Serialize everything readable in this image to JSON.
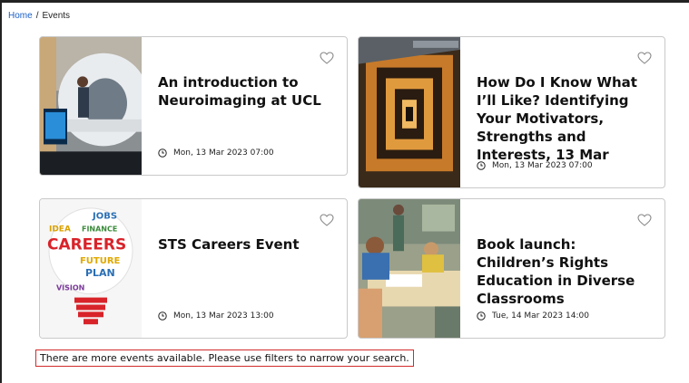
{
  "breadcrumb": {
    "home": "Home",
    "separator": "/",
    "current": "Events"
  },
  "colors": {
    "link": "#1a5fc8",
    "notice_border": "#d12b2b",
    "card_border": "#c9c9c9"
  },
  "icons": {
    "favourite": "heart-outline-icon",
    "time": "clock-icon"
  },
  "events": [
    {
      "title": "An introduction to Neuroimaging at UCL",
      "date": "Mon, 13 Mar 2023 07:00"
    },
    {
      "title": "How Do I Know What I’ll Like? Identifying Your Motivators, Strengths and Interests, 13 Mar",
      "date": "Mon, 13 Mar 2023 07:00"
    },
    {
      "title": "STS Careers Event",
      "date": "Mon, 13 Mar 2023 13:00"
    },
    {
      "title": "Book launch: Children’s Rights Education in Diverse Classrooms",
      "date": "Tue, 14 Mar 2023 14:00"
    }
  ],
  "thumb_words": [
    "JOBS",
    "IDEA",
    "FINANCE",
    "CAREERS",
    "FUTURE",
    "PLAN",
    "VISION"
  ],
  "notice": "There are more events available. Please use filters to narrow your search."
}
